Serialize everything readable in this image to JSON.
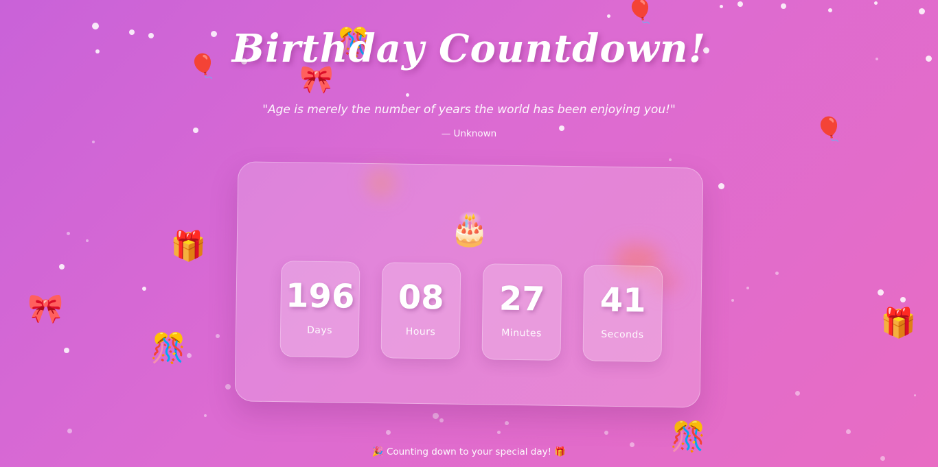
{
  "header": {
    "title": "Birthday Countdown!",
    "quote": "\"Age is merely the number of years the world has been enjoying you!\"",
    "author": "— Unknown"
  },
  "countdown": {
    "icon": "🎂",
    "units": [
      {
        "value": "196",
        "label": "Days"
      },
      {
        "value": "08",
        "label": "Hours"
      },
      {
        "value": "27",
        "label": "Minutes"
      },
      {
        "value": "41",
        "label": "Seconds"
      }
    ]
  },
  "footer": {
    "text": "🎉 Counting down to your special day! 🎁"
  },
  "decorations": {
    "balloon": "🎈",
    "ribbon": "🎀",
    "gift": "🎁",
    "confetti": "🎊"
  },
  "colors": {
    "background_start": "#c962d8",
    "background_end": "#e86cc3"
  }
}
